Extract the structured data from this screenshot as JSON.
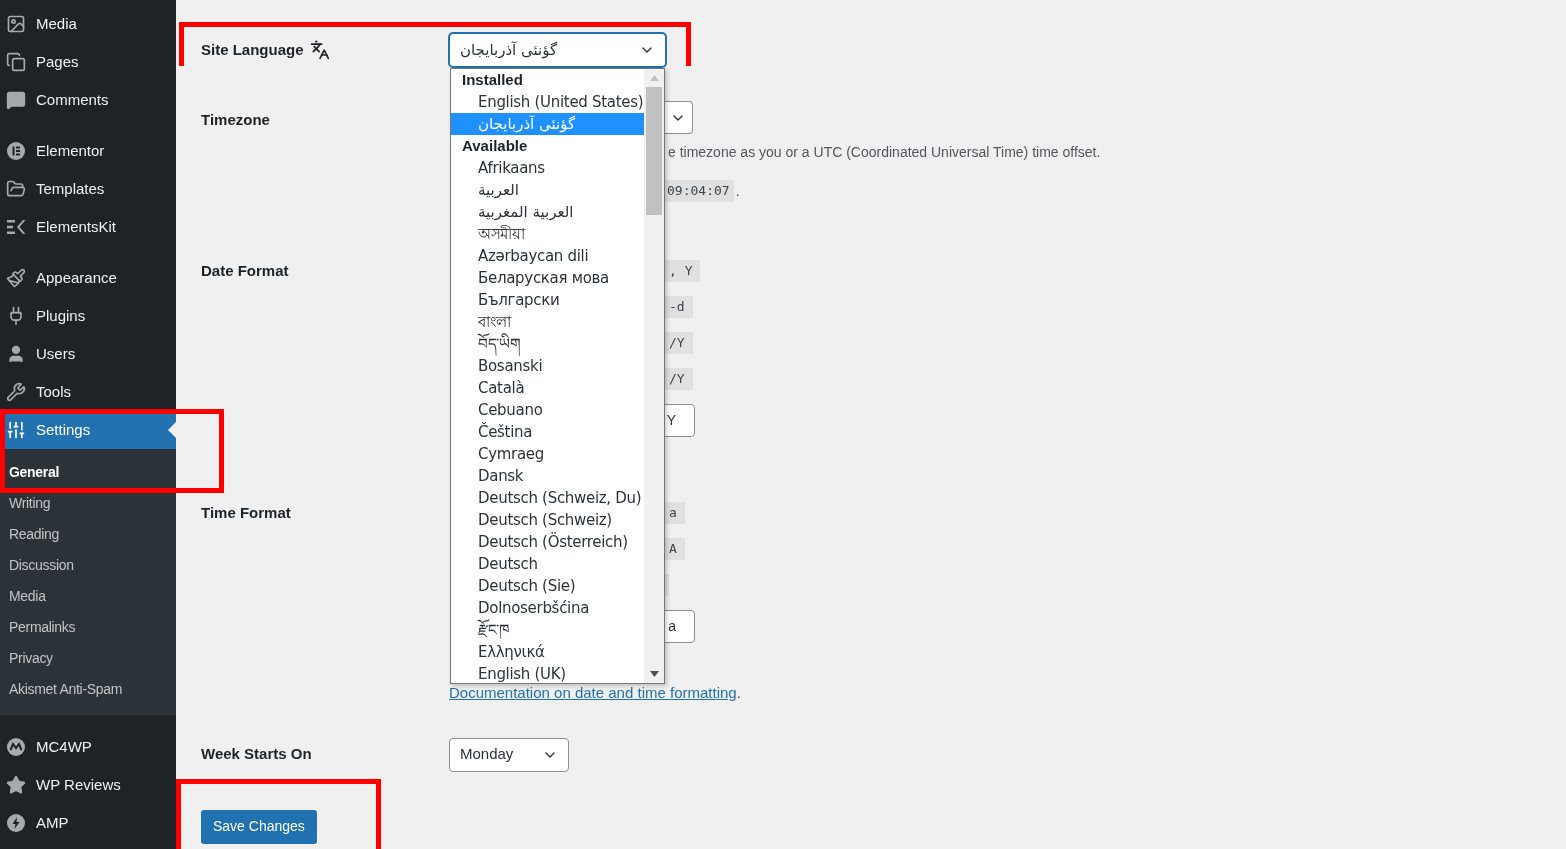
{
  "sidebar": {
    "sections": [
      [
        {
          "label": "Media",
          "selected": false
        },
        {
          "label": "Pages",
          "selected": false
        },
        {
          "label": "Comments",
          "selected": false
        }
      ],
      [
        {
          "label": "Elementor",
          "selected": false
        },
        {
          "label": "Templates",
          "selected": false
        },
        {
          "label": "ElementsKit",
          "selected": false
        }
      ],
      [
        {
          "label": "Appearance",
          "selected": false
        },
        {
          "label": "Plugins",
          "selected": false
        },
        {
          "label": "Users",
          "selected": false
        },
        {
          "label": "Tools",
          "selected": false
        },
        {
          "label": "Settings",
          "selected": true,
          "submenu": [
            {
              "label": "General",
              "selected": true
            },
            {
              "label": "Writing",
              "selected": false
            },
            {
              "label": "Reading",
              "selected": false
            },
            {
              "label": "Discussion",
              "selected": false
            },
            {
              "label": "Media",
              "selected": false
            },
            {
              "label": "Permalinks",
              "selected": false
            },
            {
              "label": "Privacy",
              "selected": false
            },
            {
              "label": "Akismet Anti-Spam",
              "selected": false
            }
          ]
        }
      ],
      [
        {
          "label": "MC4WP",
          "selected": false
        },
        {
          "label": "WP Reviews",
          "selected": false
        },
        {
          "label": "AMP",
          "selected": false
        }
      ]
    ]
  },
  "form": {
    "site_language": {
      "label": "Site Language",
      "value": "گؤنئی آذربایجان"
    },
    "timezone": {
      "label": "Timezone",
      "hint": "e timezone as you or a UTC (Coordinated Universal Time) time offset.",
      "time": "09:04:07",
      "time_suffix": "."
    },
    "date_format": {
      "label": "Date Format",
      "fragments": [
        {
          "kind": "code",
          "text": ", Y"
        },
        {
          "kind": "code",
          "text": "-d"
        },
        {
          "kind": "code",
          "text": "/Y"
        },
        {
          "kind": "code",
          "text": "/Y"
        },
        {
          "kind": "input",
          "text": "Y"
        }
      ]
    },
    "time_format": {
      "label": "Time Format",
      "fragments": [
        {
          "kind": "code",
          "text": "a"
        },
        {
          "kind": "code",
          "text": "A"
        },
        {
          "kind": "blank"
        },
        {
          "kind": "input",
          "text": "a"
        }
      ]
    },
    "doc_link": "Documentation on date and time formatting",
    "doc_suffix": ".",
    "week_starts_on": {
      "label": "Week Starts On",
      "value": "Monday"
    },
    "save_button": "Save Changes"
  },
  "language_dropdown": {
    "groups": [
      {
        "label": "Installed",
        "options": [
          {
            "label": "English (United States)",
            "selected": false
          },
          {
            "label": "گؤنئی آذربایجان",
            "selected": true
          }
        ]
      },
      {
        "label": "Available",
        "options": [
          {
            "label": "Afrikaans",
            "selected": false
          },
          {
            "label": "العربية",
            "selected": false
          },
          {
            "label": "العربية المغربية",
            "selected": false
          },
          {
            "label": "অসমীয়া",
            "selected": false
          },
          {
            "label": "Azərbaycan dili",
            "selected": false
          },
          {
            "label": "Беларуская мова",
            "selected": false
          },
          {
            "label": "Български",
            "selected": false
          },
          {
            "label": "বাংলা",
            "selected": false
          },
          {
            "label": "བོད་ཡིག",
            "selected": false
          },
          {
            "label": "Bosanski",
            "selected": false
          },
          {
            "label": "Català",
            "selected": false
          },
          {
            "label": "Cebuano",
            "selected": false
          },
          {
            "label": "Čeština",
            "selected": false
          },
          {
            "label": "Cymraeg",
            "selected": false
          },
          {
            "label": "Dansk",
            "selected": false
          },
          {
            "label": "Deutsch (Schweiz, Du)",
            "selected": false
          },
          {
            "label": "Deutsch (Schweiz)",
            "selected": false
          },
          {
            "label": "Deutsch (Österreich)",
            "selected": false
          },
          {
            "label": "Deutsch",
            "selected": false
          },
          {
            "label": "Deutsch (Sie)",
            "selected": false
          },
          {
            "label": "Dolnoserbšćina",
            "selected": false
          },
          {
            "label": "རྫོང་ཁ",
            "selected": false
          },
          {
            "label": "Ελληνικά",
            "selected": false
          },
          {
            "label": "English (UK)",
            "selected": false
          }
        ]
      }
    ]
  }
}
